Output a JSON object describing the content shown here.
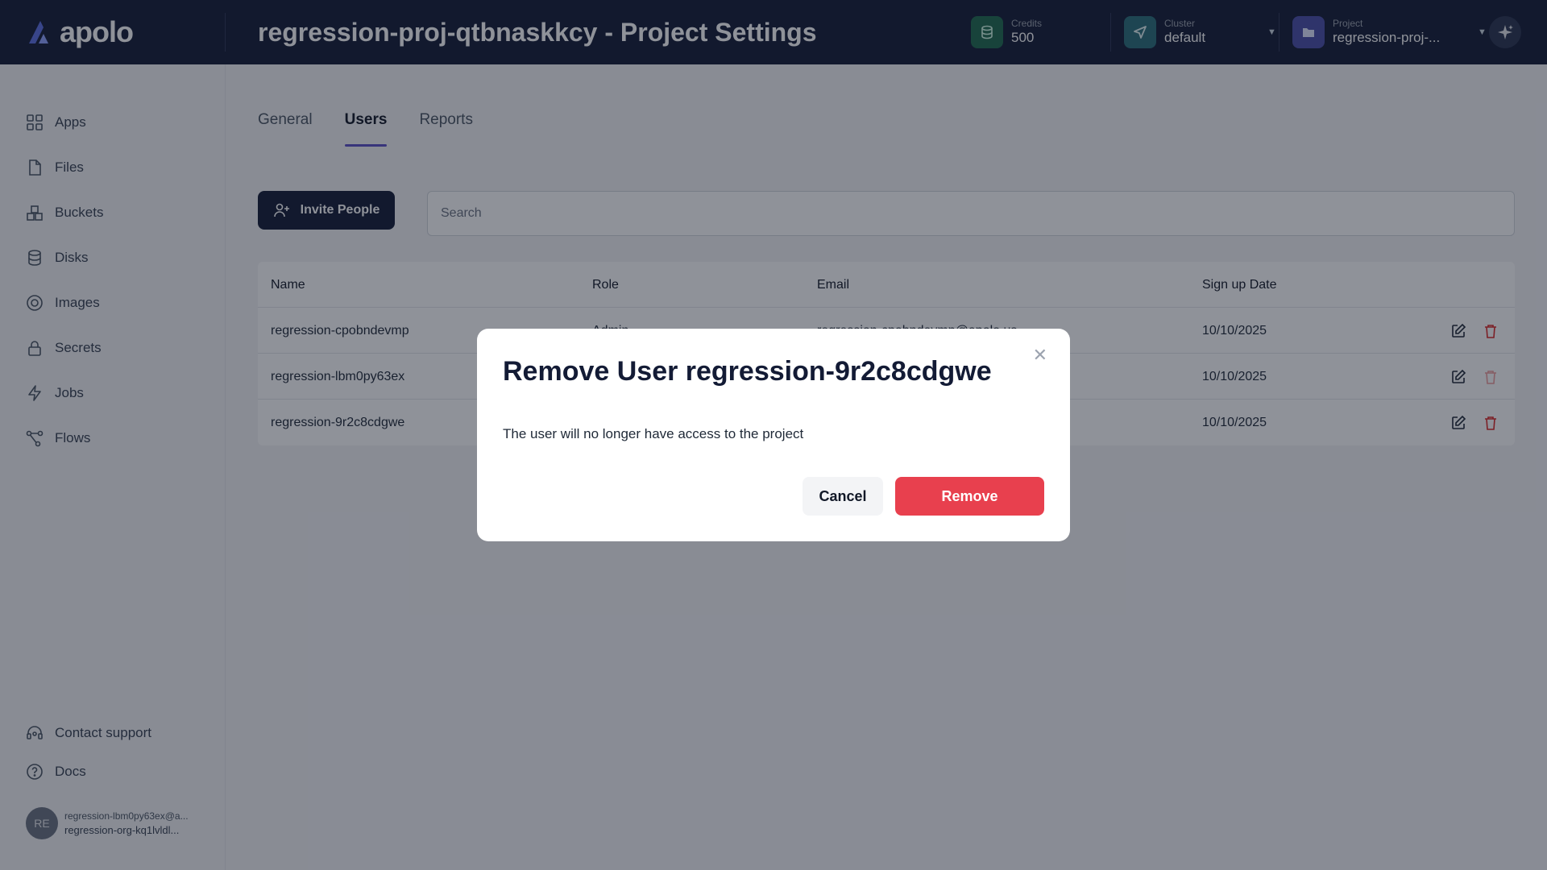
{
  "app": {
    "logo_text": "apolo"
  },
  "header": {
    "title": "regression-proj-qtbnaskkcy - Project Settings",
    "credits": {
      "label": "Credits",
      "value": "500"
    },
    "cluster": {
      "label": "Cluster",
      "value": "default"
    },
    "project": {
      "label": "Project",
      "value": "regression-proj-..."
    }
  },
  "sidebar": {
    "items": [
      {
        "label": "Apps",
        "icon": "grid-icon"
      },
      {
        "label": "Files",
        "icon": "file-icon"
      },
      {
        "label": "Buckets",
        "icon": "bucket-icon"
      },
      {
        "label": "Disks",
        "icon": "database-icon"
      },
      {
        "label": "Images",
        "icon": "image-icon"
      },
      {
        "label": "Secrets",
        "icon": "lock-icon"
      },
      {
        "label": "Jobs",
        "icon": "bolt-icon"
      },
      {
        "label": "Flows",
        "icon": "flow-icon"
      }
    ],
    "footer": [
      {
        "label": "Contact support",
        "icon": "headset-icon"
      },
      {
        "label": "Docs",
        "icon": "help-icon"
      }
    ],
    "user": {
      "initials": "RE",
      "email": "regression-lbm0py63ex@a...",
      "org": "regression-org-kq1lvldl..."
    }
  },
  "tabs": [
    {
      "label": "General",
      "active": false
    },
    {
      "label": "Users",
      "active": true
    },
    {
      "label": "Reports",
      "active": false
    }
  ],
  "toolbar": {
    "invite_label": "Invite People"
  },
  "search": {
    "placeholder": "Search"
  },
  "table": {
    "headers": [
      "Name",
      "Role",
      "Email",
      "Sign up Date"
    ],
    "rows": [
      {
        "name": "regression-cpobndevmp",
        "role": "Admin",
        "email": "regression-cpobndevmp@apolo.us",
        "date": "10/10/2025"
      },
      {
        "name": "regression-lbm0py63ex",
        "role": "",
        "email": "",
        "date": "10/10/2025"
      },
      {
        "name": "regression-9r2c8cdgwe",
        "role": "",
        "email": "",
        "date": "10/10/2025"
      }
    ]
  },
  "modal": {
    "title": "Remove User regression-9r2c8cdgwe",
    "message": "The user will no longer have access to the project",
    "cancel_label": "Cancel",
    "remove_label": "Remove"
  },
  "colors": {
    "topbar": "#131b35",
    "accent": "#5b4fc7",
    "danger": "#e8404e",
    "credits_icon_bg": "#1f6b4f",
    "cluster_icon_bg": "#2a6f7a",
    "project_icon_bg": "#4a4fa8"
  }
}
